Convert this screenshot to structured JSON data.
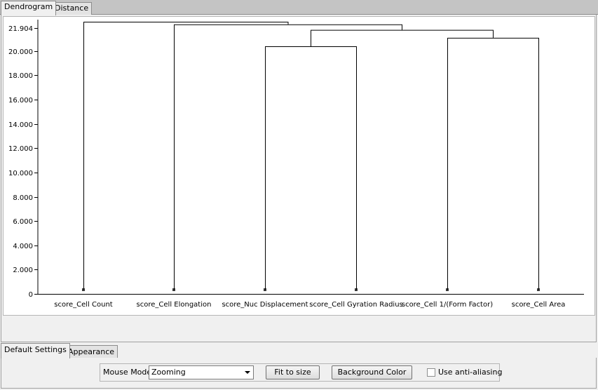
{
  "top_tabs": [
    {
      "label": "Dendrogram",
      "active": true
    },
    {
      "label": "Distance",
      "active": false
    }
  ],
  "chart_data": {
    "type": "dendrogram",
    "y_ticks": [
      {
        "label": "0",
        "value": 0
      },
      {
        "label": "2.000",
        "value": 2
      },
      {
        "label": "4.000",
        "value": 4
      },
      {
        "label": "6.000",
        "value": 6
      },
      {
        "label": "8.000",
        "value": 8
      },
      {
        "label": "10.000",
        "value": 10
      },
      {
        "label": "12.000",
        "value": 12
      },
      {
        "label": "14.000",
        "value": 14
      },
      {
        "label": "16.000",
        "value": 16
      },
      {
        "label": "18.000",
        "value": 18
      },
      {
        "label": "20.000",
        "value": 20
      },
      {
        "label": "21.904",
        "value": 21.904
      }
    ],
    "ylim": [
      0,
      21.904
    ],
    "leaves": [
      "score_Cell Count",
      "score_Cell Elongation",
      "score_Nuc Displacement",
      "score_Cell Gyration Radius",
      "score_Cell 1/(Form Factor)",
      "score_Cell Area"
    ],
    "merges": [
      {
        "left": 2,
        "right": 3,
        "height": 20.4
      },
      {
        "left": 4,
        "right": 5,
        "height": 21.1
      },
      {
        "left": 6,
        "right": 7,
        "height": 21.75
      },
      {
        "left": 1,
        "right": 8,
        "height": 22.2
      },
      {
        "left": 0,
        "right": 9,
        "height": 22.42
      }
    ]
  },
  "bottom_tabs": [
    {
      "label": "Default Settings",
      "active": true
    },
    {
      "label": "Appearance",
      "active": false
    }
  ],
  "controls": {
    "mouse_mode_label": "Mouse Mode",
    "mouse_mode_value": "Zooming",
    "fit_button": "Fit to size",
    "background_button": "Background Color",
    "antialias_label": "Use anti-aliasing",
    "antialias_checked": false
  }
}
